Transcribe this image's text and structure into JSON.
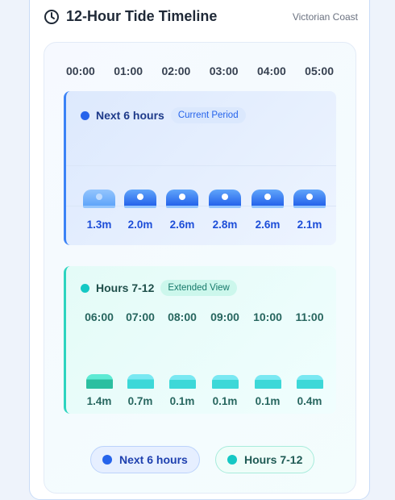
{
  "header": {
    "title": "12-Hour Tide Timeline",
    "region": "Victorian Coast",
    "icon": "clock-icon"
  },
  "colors": {
    "primary": "#3b82f6",
    "secondary": "#2dd4bf"
  },
  "chart_data": {
    "type": "bar",
    "unit": "m",
    "series": [
      {
        "name": "Next 6 hours",
        "badge": "Current Period",
        "times": [
          "00:00",
          "01:00",
          "02:00",
          "03:00",
          "04:00",
          "05:00"
        ],
        "values": [
          1.3,
          2.0,
          2.6,
          2.8,
          2.6,
          2.1
        ],
        "labels": [
          "1.3m",
          "2.0m",
          "2.6m",
          "2.8m",
          "2.6m",
          "2.1m"
        ],
        "color": "#3b82f6"
      },
      {
        "name": "Hours 7-12",
        "badge": "Extended View",
        "times": [
          "06:00",
          "07:00",
          "08:00",
          "09:00",
          "10:00",
          "11:00"
        ],
        "values": [
          1.4,
          0.7,
          0.1,
          0.1,
          0.1,
          0.4
        ],
        "labels": [
          "1.4m",
          "0.7m",
          "0.1m",
          "0.1m",
          "0.1m",
          "0.4m"
        ],
        "color": "#2dd4bf"
      }
    ]
  },
  "legend": [
    "Next 6 hours",
    "Hours 7-12"
  ]
}
